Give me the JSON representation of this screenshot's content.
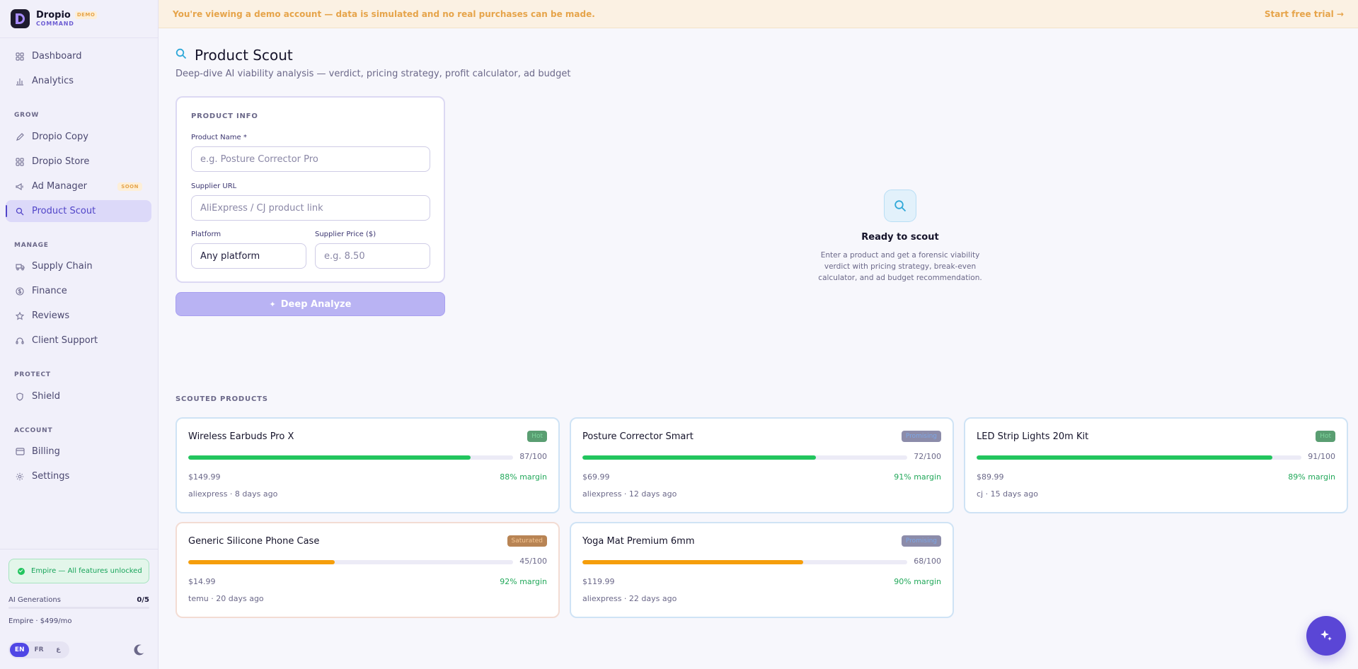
{
  "brand": {
    "name": "Dropio",
    "badge": "DEMO",
    "subtitle": "COMMAND"
  },
  "nav": {
    "top": [
      {
        "label": "Dashboard",
        "icon": "grid-icon"
      },
      {
        "label": "Analytics",
        "icon": "bar-chart-icon"
      }
    ],
    "grow_label": "GROW",
    "grow": [
      {
        "label": "Dropio Copy",
        "icon": "pencil-icon"
      },
      {
        "label": "Dropio Store",
        "icon": "grid-icon"
      },
      {
        "label": "Ad Manager",
        "icon": "megaphone-icon",
        "badge": "SOON"
      },
      {
        "label": "Product Scout",
        "icon": "search-icon",
        "active": true
      }
    ],
    "manage_label": "MANAGE",
    "manage": [
      {
        "label": "Supply Chain",
        "icon": "truck-icon"
      },
      {
        "label": "Finance",
        "icon": "dollar-icon"
      },
      {
        "label": "Reviews",
        "icon": "star-icon"
      },
      {
        "label": "Client Support",
        "icon": "headset-icon"
      }
    ],
    "protect_label": "PROTECT",
    "protect": [
      {
        "label": "Shield",
        "icon": "shield-icon"
      }
    ],
    "account_label": "ACCOUNT",
    "account": [
      {
        "label": "Billing",
        "icon": "card-icon"
      },
      {
        "label": "Settings",
        "icon": "gear-icon"
      }
    ]
  },
  "sidebar_bottom": {
    "plan_status": "Empire — All features unlocked",
    "generations_label": "AI Generations",
    "generations_count": "0/5",
    "generations_used_fraction": 0,
    "plan_line": "Empire · $499/mo",
    "languages": [
      "EN",
      "FR",
      "ع"
    ],
    "active_language": "EN"
  },
  "banner": {
    "message": "You're viewing a demo account — data is simulated and no real purchases can be made.",
    "cta": "Start free trial →"
  },
  "page": {
    "title": "Product Scout",
    "subtitle": "Deep-dive AI viability analysis — verdict, pricing strategy, profit calculator, ad budget"
  },
  "form": {
    "heading": "PRODUCT INFO",
    "product_name_label": "Product Name *",
    "product_name_placeholder": "e.g. Posture Corrector Pro",
    "supplier_url_label": "Supplier URL",
    "supplier_url_placeholder": "AliExpress / CJ product link",
    "platform_label": "Platform",
    "platform_value": "Any platform",
    "price_label": "Supplier Price ($)",
    "price_placeholder": "e.g. 8.50",
    "button": "Deep Analyze"
  },
  "empty_state": {
    "title": "Ready to scout",
    "description": "Enter a product and get a forensic viability verdict with pricing strategy, break-even calculator, and ad budget recommendation."
  },
  "scouted": {
    "heading": "SCOUTED PRODUCTS",
    "products": [
      {
        "name": "Wireless Earbuds Pro X",
        "badge": "Hot",
        "status": "hot",
        "score": 87,
        "score_text": "87/100",
        "price": "$149.99",
        "margin": "88% margin",
        "meta": "aliexpress · 8 days ago",
        "bar_color": "#22c55e"
      },
      {
        "name": "Posture Corrector Smart",
        "badge": "Promising",
        "status": "prom",
        "score": 72,
        "score_text": "72/100",
        "price": "$69.99",
        "margin": "91% margin",
        "meta": "aliexpress · 12 days ago",
        "bar_color": "#22c55e"
      },
      {
        "name": "LED Strip Lights 20m Kit",
        "badge": "Hot",
        "status": "hot",
        "score": 91,
        "score_text": "91/100",
        "price": "$89.99",
        "margin": "89% margin",
        "meta": "cj · 15 days ago",
        "bar_color": "#22c55e"
      },
      {
        "name": "Generic Silicone Phone Case",
        "badge": "Saturated",
        "status": "sat",
        "score": 45,
        "score_text": "45/100",
        "price": "$14.99",
        "margin": "92% margin",
        "meta": "temu · 20 days ago",
        "bar_color": "#f59e0b"
      },
      {
        "name": "Yoga Mat Premium 6mm",
        "badge": "Promising",
        "status": "prom",
        "score": 68,
        "score_text": "68/100",
        "price": "$119.99",
        "margin": "90% margin",
        "meta": "aliexpress · 22 days ago",
        "bar_color": "#f59e0b"
      }
    ]
  },
  "colors": {
    "accent": "#5145c8",
    "success": "#22c55e",
    "warning": "#f59e0b",
    "banner": "#e6a44a"
  }
}
